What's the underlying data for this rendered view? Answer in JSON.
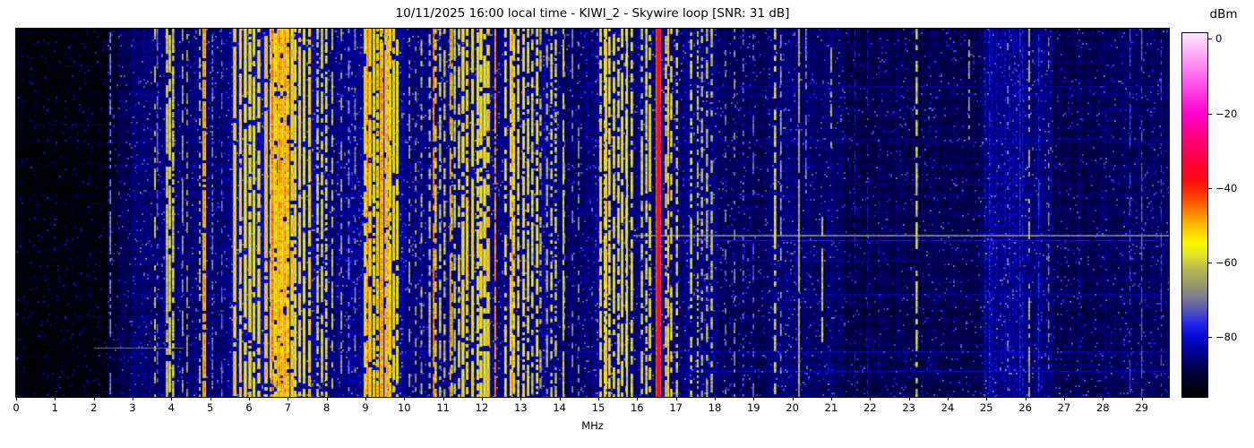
{
  "chart_data": {
    "type": "heatmap-spectrogram",
    "title": "10/11/2025 16:00 local time - KIWI_2 - Skywire loop [SNR: 31 dB]",
    "xlabel": "MHz",
    "x_ticks": [
      "0",
      "1",
      "2",
      "3",
      "4",
      "5",
      "6",
      "7",
      "8",
      "9",
      "10",
      "11",
      "12",
      "13",
      "14",
      "15",
      "16",
      "17",
      "18",
      "19",
      "20",
      "21",
      "22",
      "23",
      "24",
      "25",
      "26",
      "27",
      "28",
      "29"
    ],
    "x_range_mhz": [
      0,
      29.7
    ],
    "value_unit": "dBm",
    "colorbar": {
      "label": "dBm",
      "tick_labels": [
        "0",
        "−20",
        "−40",
        "−60",
        "−80"
      ],
      "tick_values": [
        0,
        -20,
        -40,
        -60,
        -80
      ],
      "vmax": 1.5,
      "vmin": -96,
      "stops": [
        {
          "v": -96,
          "c": "#000000"
        },
        {
          "v": -90,
          "c": "#000032"
        },
        {
          "v": -84,
          "c": "#00008c"
        },
        {
          "v": -80,
          "c": "#000ad2"
        },
        {
          "v": -76,
          "c": "#2828eb"
        },
        {
          "v": -72,
          "c": "#5f5fb4"
        },
        {
          "v": -67,
          "c": "#919173"
        },
        {
          "v": -62,
          "c": "#b4b455"
        },
        {
          "v": -58,
          "c": "#e1e12d"
        },
        {
          "v": -55,
          "c": "#fcfa00"
        },
        {
          "v": -51,
          "c": "#ffc800"
        },
        {
          "v": -47,
          "c": "#ff8c00"
        },
        {
          "v": -42,
          "c": "#ff3c00"
        },
        {
          "v": -38,
          "c": "#ff0a0a"
        },
        {
          "v": -33,
          "c": "#ff003c"
        },
        {
          "v": -27,
          "c": "#ff0078"
        },
        {
          "v": -20,
          "c": "#ff00cd"
        },
        {
          "v": -12,
          "c": "#ff55eb"
        },
        {
          "v": -5,
          "c": "#ffa0f5"
        },
        {
          "v": 0,
          "c": "#ffd7fa"
        },
        {
          "v": 1.5,
          "c": "#ffe8fc"
        }
      ]
    },
    "noise_floor": [
      {
        "from": 0.0,
        "to": 2.35,
        "level": -97
      },
      {
        "from": 2.35,
        "to": 2.6,
        "level": -93
      },
      {
        "from": 2.6,
        "to": 2.95,
        "level": -90
      },
      {
        "from": 2.95,
        "to": 5.55,
        "level": -88
      },
      {
        "from": 5.55,
        "to": 7.65,
        "level": -84
      },
      {
        "from": 7.65,
        "to": 8.9,
        "level": -86.5
      },
      {
        "from": 8.9,
        "to": 10.0,
        "level": -85
      },
      {
        "from": 10.0,
        "to": 11.45,
        "level": -87
      },
      {
        "from": 11.45,
        "to": 12.3,
        "level": -85.5
      },
      {
        "from": 12.3,
        "to": 14.0,
        "level": -87
      },
      {
        "from": 14.0,
        "to": 14.95,
        "level": -88.5
      },
      {
        "from": 14.95,
        "to": 16.05,
        "level": -86.5
      },
      {
        "from": 16.05,
        "to": 18.1,
        "level": -87.5
      },
      {
        "from": 18.1,
        "to": 19.35,
        "level": -89.5
      },
      {
        "from": 19.35,
        "to": 21.3,
        "level": -88.5
      },
      {
        "from": 21.3,
        "to": 24.9,
        "level": -90.5
      },
      {
        "from": 24.9,
        "to": 26.7,
        "level": -87
      },
      {
        "from": 26.7,
        "to": 27.9,
        "level": -90.5
      },
      {
        "from": 27.9,
        "to": 29.7,
        "level": -89.5
      }
    ],
    "bands": [
      {
        "from": 3.85,
        "to": 4.08,
        "spacing": 0.09,
        "width": 0.05,
        "level": -56,
        "dash": 0.8
      },
      {
        "from": 4.28,
        "to": 4.52,
        "spacing": 0.1,
        "width": 0.04,
        "level": -62,
        "dash": 0.55
      },
      {
        "from": 4.7,
        "to": 4.8,
        "spacing": 0.09,
        "width": 0.04,
        "level": -60,
        "dash": 0.5
      },
      {
        "from": 5.6,
        "to": 6.35,
        "spacing": 0.11,
        "width": 0.06,
        "level": -52,
        "dash": 0.85
      },
      {
        "from": 6.4,
        "to": 7.05,
        "spacing": 0.1,
        "width": 0.065,
        "level": -49,
        "dash": 0.9
      },
      {
        "from": 7.08,
        "to": 7.62,
        "spacing": 0.11,
        "width": 0.06,
        "level": -52,
        "dash": 0.85
      },
      {
        "from": 7.7,
        "to": 8.2,
        "spacing": 0.14,
        "width": 0.05,
        "level": -57,
        "dash": 0.65
      },
      {
        "from": 8.3,
        "to": 8.85,
        "spacing": 0.18,
        "width": 0.04,
        "level": -63,
        "dash": 0.45
      },
      {
        "from": 8.95,
        "to": 9.95,
        "spacing": 0.11,
        "width": 0.06,
        "level": -51,
        "dash": 0.85
      },
      {
        "from": 10.05,
        "to": 10.55,
        "spacing": 0.18,
        "width": 0.04,
        "level": -63,
        "dash": 0.4
      },
      {
        "from": 10.6,
        "to": 11.12,
        "spacing": 0.15,
        "width": 0.05,
        "level": -58,
        "dash": 0.55
      },
      {
        "from": 11.18,
        "to": 11.45,
        "spacing": 0.12,
        "width": 0.05,
        "level": -58,
        "dash": 0.6
      },
      {
        "from": 11.5,
        "to": 12.25,
        "spacing": 0.11,
        "width": 0.06,
        "level": -52,
        "dash": 0.8
      },
      {
        "from": 12.55,
        "to": 13.45,
        "spacing": 0.12,
        "width": 0.055,
        "level": -55,
        "dash": 0.75
      },
      {
        "from": 13.5,
        "to": 14.0,
        "spacing": 0.15,
        "width": 0.05,
        "level": -59,
        "dash": 0.55
      },
      {
        "from": 14.05,
        "to": 14.6,
        "spacing": 0.2,
        "width": 0.04,
        "level": -66,
        "dash": 0.35
      },
      {
        "from": 15.05,
        "to": 15.9,
        "spacing": 0.12,
        "width": 0.055,
        "level": -54,
        "dash": 0.75
      },
      {
        "from": 16.12,
        "to": 16.42,
        "spacing": 0.11,
        "width": 0.05,
        "level": -55,
        "dash": 0.7
      },
      {
        "from": 16.68,
        "to": 17.12,
        "spacing": 0.13,
        "width": 0.05,
        "level": -57,
        "dash": 0.6
      },
      {
        "from": 17.38,
        "to": 18.02,
        "spacing": 0.13,
        "width": 0.05,
        "level": -59,
        "dash": 0.55
      },
      {
        "from": 18.2,
        "to": 19.1,
        "spacing": 0.22,
        "width": 0.04,
        "level": -67,
        "dash": 0.3
      },
      {
        "from": 21.6,
        "to": 22.3,
        "spacing": 0.25,
        "width": 0.035,
        "level": -80,
        "dash": 0.4
      },
      {
        "from": 24.95,
        "to": 25.95,
        "spacing": 0.09,
        "width": 0.05,
        "level": -79,
        "dash": 0.85
      },
      {
        "from": 27.0,
        "to": 28.2,
        "spacing": 0.3,
        "width": 0.03,
        "level": -84,
        "dash": 0.4
      }
    ],
    "signals": [
      {
        "f": 2.43,
        "width": 0.035,
        "level": -64,
        "dash": 0.6
      },
      {
        "f": 3.58,
        "width": 0.04,
        "level": -58,
        "dash": 0.5
      },
      {
        "f": 3.64,
        "width": 0.03,
        "level": -68,
        "dash": 0.5
      },
      {
        "f": 4.85,
        "width": 0.06,
        "level": -45,
        "dash": 0.92
      },
      {
        "f": 5.06,
        "width": 0.03,
        "level": -66,
        "dash": 0.5
      },
      {
        "f": 5.3,
        "width": 0.03,
        "level": -68,
        "dash": 0.4
      },
      {
        "f": 6.6,
        "width": 0.07,
        "level": -44,
        "dash": 0.95
      },
      {
        "f": 6.78,
        "width": 0.06,
        "level": -46,
        "dash": 0.9
      },
      {
        "f": 9.05,
        "width": 0.04,
        "level": -44,
        "dash": 0.9
      },
      {
        "f": 9.42,
        "width": 0.08,
        "level": -47,
        "dash": 0.95
      },
      {
        "f": 9.58,
        "width": 0.07,
        "level": -48,
        "dash": 0.9
      },
      {
        "f": 10.75,
        "width": 0.03,
        "level": -42,
        "dash": 0.92
      },
      {
        "f": 11.2,
        "width": 0.028,
        "level": -42,
        "dash": 0.88
      },
      {
        "f": 12.35,
        "width": 0.028,
        "level": -43,
        "dash": 0.88
      },
      {
        "f": 12.78,
        "width": 0.045,
        "level": -46,
        "dash": 0.85
      },
      {
        "f": 14.1,
        "width": 0.035,
        "level": -56,
        "dash": 0.8
      },
      {
        "f": 15.2,
        "width": 0.05,
        "level": -50,
        "dash": 0.85
      },
      {
        "f": 15.74,
        "width": 0.035,
        "level": -54,
        "dash": 0.95
      },
      {
        "f": 16.55,
        "width": 0.1,
        "level": -31,
        "dash": 1.0
      },
      {
        "f": 16.8,
        "width": 0.045,
        "level": -50,
        "dash": 0.8
      },
      {
        "f": 19.55,
        "width": 0.05,
        "level": -56,
        "dash": 0.7
      },
      {
        "f": 19.7,
        "width": 0.03,
        "level": -62,
        "dash": 0.5
      },
      {
        "f": 20.17,
        "width": 0.022,
        "level": -60,
        "dash": 0.97
      },
      {
        "f": 20.35,
        "width": 0.03,
        "level": -66,
        "dash": 0.55,
        "y0": 0.0,
        "y1": 0.45
      },
      {
        "f": 20.77,
        "width": 0.04,
        "level": -57,
        "dash": 0.8,
        "y0": 0.5,
        "y1": 0.85
      },
      {
        "f": 21.0,
        "width": 0.03,
        "level": -60,
        "dash": 0.5,
        "y0": 0.05,
        "y1": 0.35
      },
      {
        "f": 23.2,
        "width": 0.045,
        "level": -57,
        "dash": 0.6
      },
      {
        "f": 24.55,
        "width": 0.03,
        "level": -62,
        "dash": 0.45,
        "y0": 0.0,
        "y1": 0.3
      },
      {
        "f": 25.55,
        "width": 0.03,
        "level": -66,
        "dash": 0.25
      },
      {
        "f": 26.1,
        "width": 0.04,
        "level": -61,
        "dash": 0.5
      },
      {
        "f": 26.35,
        "width": 0.03,
        "level": -74,
        "dash": 0.6
      },
      {
        "f": 26.6,
        "width": 0.028,
        "level": -66,
        "dash": 0.4
      },
      {
        "f": 28.7,
        "width": 0.03,
        "level": -72,
        "dash": 0.55
      },
      {
        "f": 29.0,
        "width": 0.032,
        "level": -70,
        "dash": 0.6
      },
      {
        "f": 29.5,
        "width": 0.025,
        "level": -73,
        "dash": 0.5
      }
    ],
    "h_streaks": [
      {
        "y": 0.1,
        "from": 1.2,
        "to": 10.5,
        "level": -84
      },
      {
        "y": 0.155,
        "from": 14.5,
        "to": 29.7,
        "level": -82
      },
      {
        "y": 0.26,
        "from": 0.5,
        "to": 6.0,
        "level": -85
      },
      {
        "y": 0.3,
        "from": 19.0,
        "to": 29.7,
        "level": -83
      },
      {
        "y": 0.42,
        "from": 21.0,
        "to": 27.5,
        "level": -83
      },
      {
        "y": 0.475,
        "from": 2.0,
        "to": 12.0,
        "level": -85
      },
      {
        "y": 0.56,
        "from": 15.9,
        "to": 29.7,
        "level": -70,
        "thick": 2
      },
      {
        "y": 0.575,
        "from": 15.9,
        "to": 29.7,
        "level": -78
      },
      {
        "y": 0.63,
        "from": 18.0,
        "to": 26.0,
        "level": -82
      },
      {
        "y": 0.72,
        "from": 20.0,
        "to": 29.7,
        "level": -82
      },
      {
        "y": 0.78,
        "from": 1.5,
        "to": 9.0,
        "level": -84
      },
      {
        "y": 0.865,
        "from": 2.0,
        "to": 4.3,
        "level": -70
      },
      {
        "y": 0.875,
        "from": 10.0,
        "to": 29.7,
        "level": -81
      },
      {
        "y": 0.93,
        "from": 17.0,
        "to": 29.7,
        "level": -80
      },
      {
        "y": 0.955,
        "from": 5.0,
        "to": 16.0,
        "level": -83
      }
    ]
  }
}
